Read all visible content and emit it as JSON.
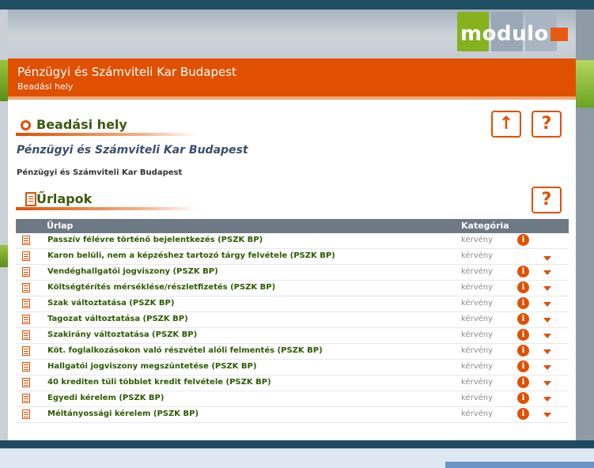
{
  "logo": {
    "text": "modulo"
  },
  "banner": {
    "title": "Pénzügyi és Számviteli Kar Budapest",
    "subtitle": "Beadási hely"
  },
  "section1": {
    "title": "Beadási hely",
    "institution_italic": "Pénzügyi és Számviteli Kar Budapest",
    "institution_small": "Pénzügyi és Számviteli Kar Budapest",
    "up_icon": "↑",
    "help_icon": "?"
  },
  "section2": {
    "title": "Űrlapok",
    "help_icon": "?"
  },
  "table": {
    "columns": [
      "Űrlap",
      "Kategória"
    ],
    "rows": [
      {
        "name": "Passzív félévre történő bejelentkezés (PSZK BP)",
        "category": "kérvény",
        "info": true,
        "arrow": false
      },
      {
        "name": "Karon belüli, nem a képzéshez tartozó tárgy felvétele (PSZK BP)",
        "category": "kérvény",
        "info": false,
        "arrow": true
      },
      {
        "name": "Vendéghallgatói jogviszony (PSZK BP)",
        "category": "kérvény",
        "info": true,
        "arrow": true
      },
      {
        "name": "Költségtérítés mérséklése/részletfizetés (PSZK BP)",
        "category": "kérvény",
        "info": true,
        "arrow": true
      },
      {
        "name": "Szak változtatása (PSZK BP)",
        "category": "kérvény",
        "info": true,
        "arrow": true
      },
      {
        "name": "Tagozat változtatása (PSZK BP)",
        "category": "kérvény",
        "info": true,
        "arrow": true
      },
      {
        "name": "Szakirány változtatása (PSZK BP)",
        "category": "kérvény",
        "info": true,
        "arrow": true
      },
      {
        "name": "Köt. foglalkozásokon való részvétel alóli felmentés (PSZK BP)",
        "category": "kérvény",
        "info": true,
        "arrow": true
      },
      {
        "name": "Hallgatói jogviszony megszüntetése (PSZK BP)",
        "category": "kérvény",
        "info": true,
        "arrow": true
      },
      {
        "name": "40 krediten túli többlet kredit felvétele (PSZK BP)",
        "category": "kérvény",
        "info": true,
        "arrow": true
      },
      {
        "name": "Egyedi kérelem (PSZK BP)",
        "category": "kérvény",
        "info": true,
        "arrow": true
      },
      {
        "name": "Méltányossági kérelem (PSZK BP)",
        "category": "kérvény",
        "info": true,
        "arrow": true
      }
    ],
    "info_glyph": "i"
  },
  "colors": {
    "accent": "#e05000",
    "green_text": "#2d5a00",
    "header_bg": "#6d7a86"
  }
}
